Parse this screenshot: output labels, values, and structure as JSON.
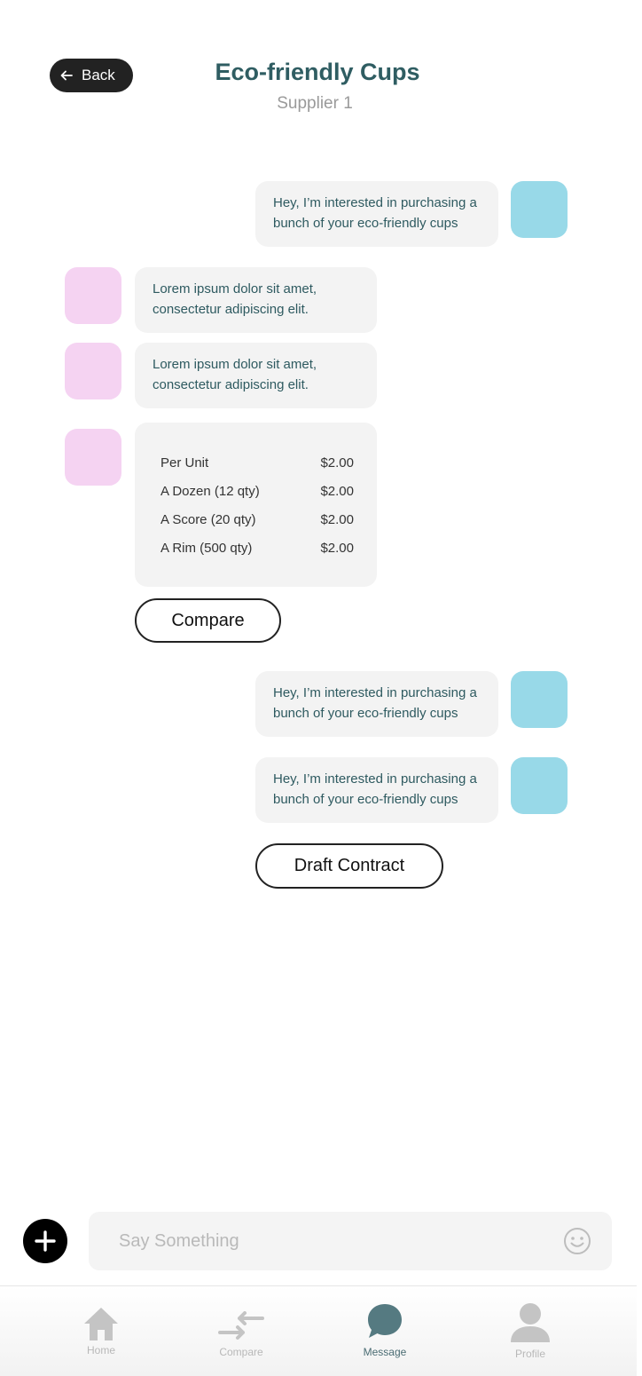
{
  "header": {
    "back_label": "Back",
    "title": "Eco-friendly Cups",
    "subtitle": "Supplier 1"
  },
  "messages": {
    "m1": "Hey, I’m interested in purchasing a bunch of your eco-friendly cups",
    "m2": "Lorem ipsum dolor sit amet, consectetur adipiscing elit.",
    "m3": "Lorem ipsum dolor sit amet, consectetur adipiscing elit.",
    "m5": "Hey, I’m interested in purchasing a bunch of your eco-friendly cups",
    "m6": "Hey, I’m interested in purchasing a bunch of your eco-friendly cups"
  },
  "pricing": [
    {
      "label": "Per Unit",
      "price": "$2.00"
    },
    {
      "label": "A Dozen (12 qty)",
      "price": "$2.00"
    },
    {
      "label": "A Score (20 qty)",
      "price": "$2.00"
    },
    {
      "label": "A Rim (500 qty)",
      "price": "$2.00"
    }
  ],
  "buttons": {
    "compare": "Compare",
    "draft_contract": "Draft Contract"
  },
  "composer": {
    "placeholder": "Say Something",
    "value": ""
  },
  "nav": [
    {
      "label": "Home",
      "icon": "home-icon"
    },
    {
      "label": "Compare",
      "icon": "compare-arrows-icon"
    },
    {
      "label": "Message",
      "icon": "chat-bubble-icon",
      "active": true
    },
    {
      "label": "Profile",
      "icon": "user-icon"
    }
  ],
  "colors": {
    "title": "#2f5d62",
    "my_avatar": "#98d9e8",
    "their_avatar": "#f5d3f2",
    "bubble": "#f3f3f3",
    "nav_active": "#4a6c73",
    "nav_inactive": "#b8b8b8"
  }
}
